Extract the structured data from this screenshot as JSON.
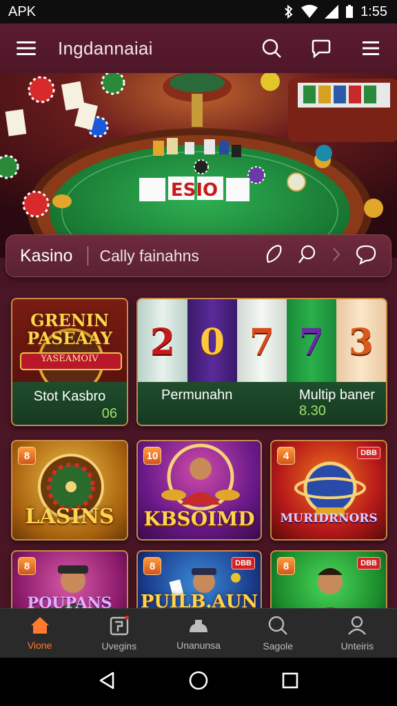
{
  "status_bar": {
    "left_label": "APK",
    "time": "1:55"
  },
  "app_bar": {
    "title": "Ingdannaiai"
  },
  "hero": {
    "table_text": "ESIO"
  },
  "category": {
    "title": "Kasino",
    "subtitle": "Cally fainahns"
  },
  "featured": [
    {
      "banner_line1": "GRENIN",
      "banner_line2": "PASEAAY",
      "ribbon": "YASEAMOIV",
      "label": "Stot Kasbro",
      "value": "06"
    },
    {
      "reels": [
        "2",
        "0",
        "7",
        "7",
        "3"
      ],
      "label": "Permunahn"
    },
    {
      "label": "Multip baner",
      "value": "8.30"
    }
  ],
  "games_row1": [
    {
      "badge": "8",
      "title": "LASINS"
    },
    {
      "badge": "10",
      "title": "KBSOIMD"
    },
    {
      "badge": "4",
      "badge_right": "DBB",
      "title": "MURIDRNORS"
    }
  ],
  "games_row2": [
    {
      "badge": "8",
      "title": "POUPANS"
    },
    {
      "badge": "8",
      "badge_right": "DBB",
      "title": "PUILB.AUN"
    },
    {
      "badge": "8",
      "badge_right": "DBB"
    }
  ],
  "bottom_nav": [
    {
      "label": "Vione",
      "icon": "home-icon",
      "active": true
    },
    {
      "label": "Uvegins",
      "icon": "gift-icon"
    },
    {
      "label": "Unanunsa",
      "icon": "chips-icon"
    },
    {
      "label": "Sagole",
      "icon": "search-icon"
    },
    {
      "label": "Unteiris",
      "icon": "profile-icon"
    }
  ],
  "colors": {
    "accent": "#ff7a2e",
    "app_bar": "#5c1b30",
    "background": "#4a1626",
    "felt": "#1f8a3c"
  }
}
